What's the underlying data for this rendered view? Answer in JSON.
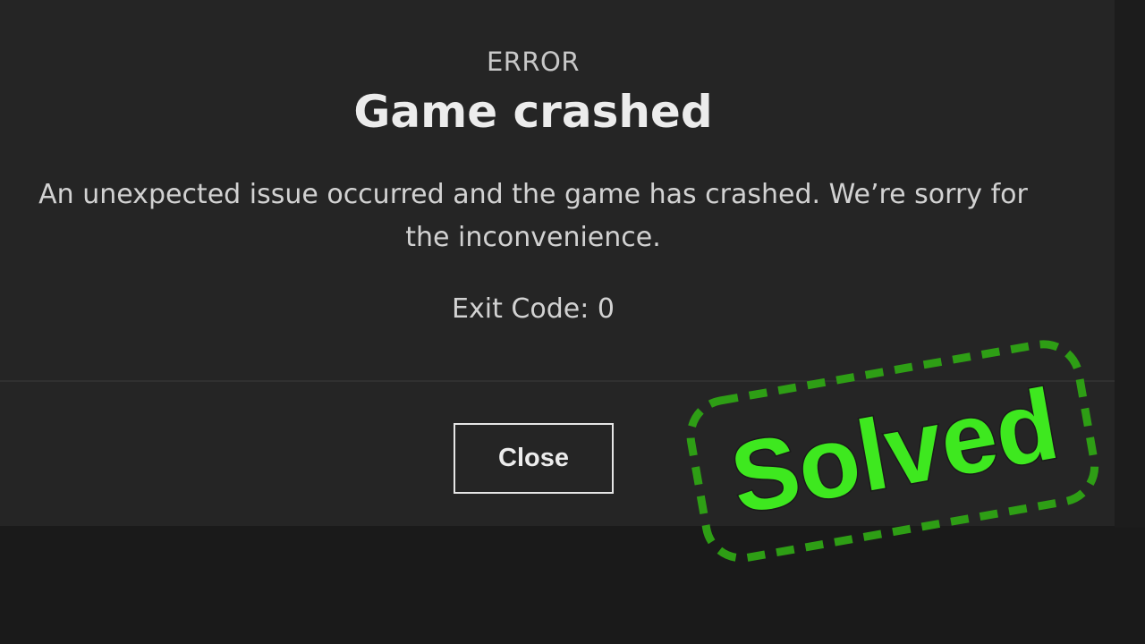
{
  "dialog": {
    "eyebrow": "ERROR",
    "title": "Game crashed",
    "message": "An unexpected issue occurred and the game has crashed. We’re sorry for the inconvenience.",
    "exit_code_label": "Exit Code:",
    "exit_code_value": "0",
    "close_label": "Close"
  },
  "overlay": {
    "badge_text": "Solved",
    "badge_color": "#3ee81f"
  },
  "colors": {
    "dialog_background": "#252525",
    "page_background": "#1a1a1a",
    "title_text": "#ececec",
    "body_text": "#d2d2d2",
    "button_border": "#e6e6e6"
  }
}
